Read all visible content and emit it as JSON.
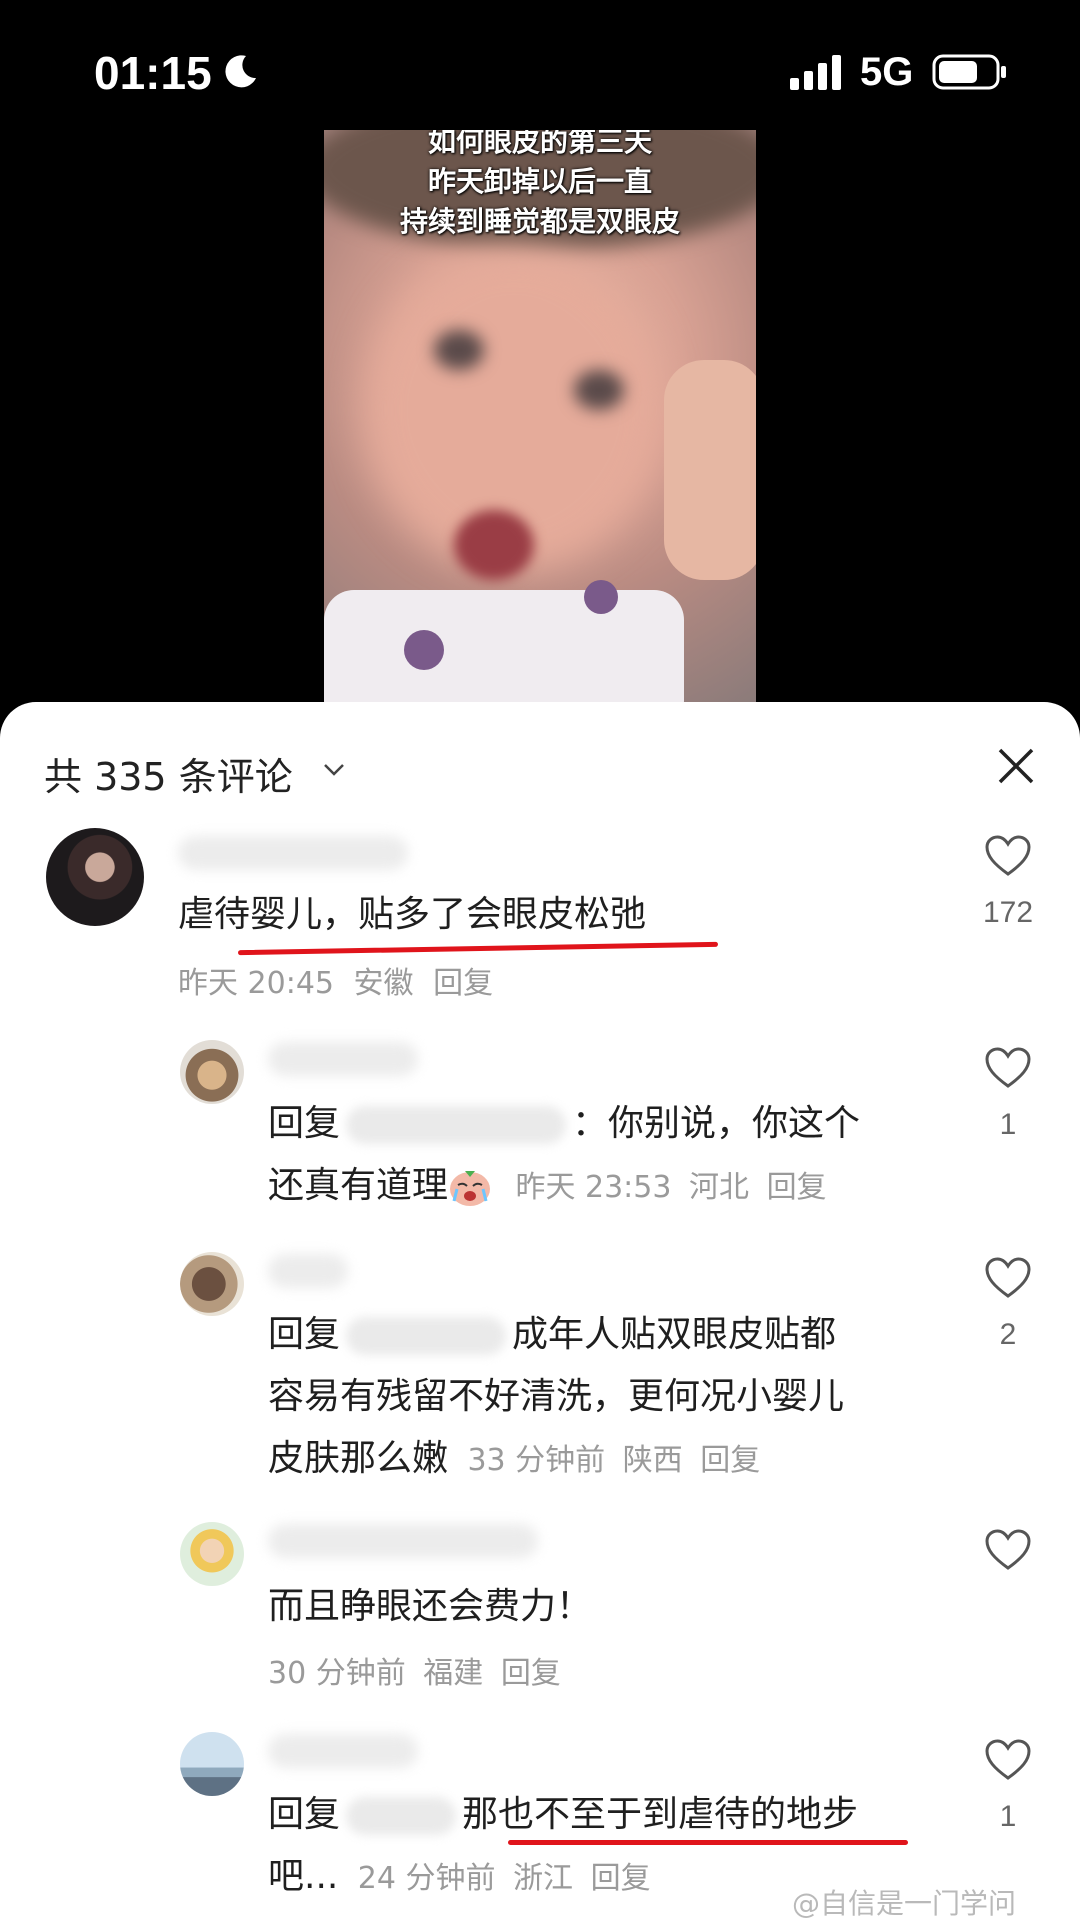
{
  "status_bar": {
    "time": "01:15",
    "network": "5G"
  },
  "video": {
    "captions": [
      "如何眼皮的第三天",
      "昨天卸掉以后一直",
      "持续到睡觉都是双眼皮"
    ]
  },
  "comments_header": {
    "title": "共 335 条评论"
  },
  "comments": [
    {
      "text": "虐待婴儿，贴多了会眼皮松弛",
      "time": "昨天 20:45",
      "location": "安徽",
      "reply_label": "回复",
      "likes": "172"
    },
    {
      "reply_prefix": "回复",
      "text_line1": "：你别说，你这个",
      "text_line2": "还真有道理",
      "time": "昨天 23:53",
      "location": "河北",
      "reply_label": "回复",
      "likes": "1"
    },
    {
      "reply_prefix": "回复",
      "text_line1": "成年人贴双眼皮贴都",
      "text_line2": "容易有残留不好清洗，更何况小婴儿",
      "text_line3": "皮肤那么嫩",
      "time": "33 分钟前",
      "location": "陕西",
      "reply_label": "回复",
      "likes": "2"
    },
    {
      "text": "而且睁眼还会费力！",
      "time": "30 分钟前",
      "location": "福建",
      "reply_label": "回复",
      "likes": ""
    },
    {
      "reply_prefix": "回复",
      "text_line1": "那也不至于到虐待的地步",
      "text_line2": "吧...",
      "time": "24 分钟前",
      "location": "浙江",
      "reply_label": "回复",
      "likes": "1"
    }
  ],
  "watermark": "@自信是一门学问",
  "colors": {
    "highlight_underline": "#e0141b",
    "meta_gray": "#9a9a9a"
  }
}
